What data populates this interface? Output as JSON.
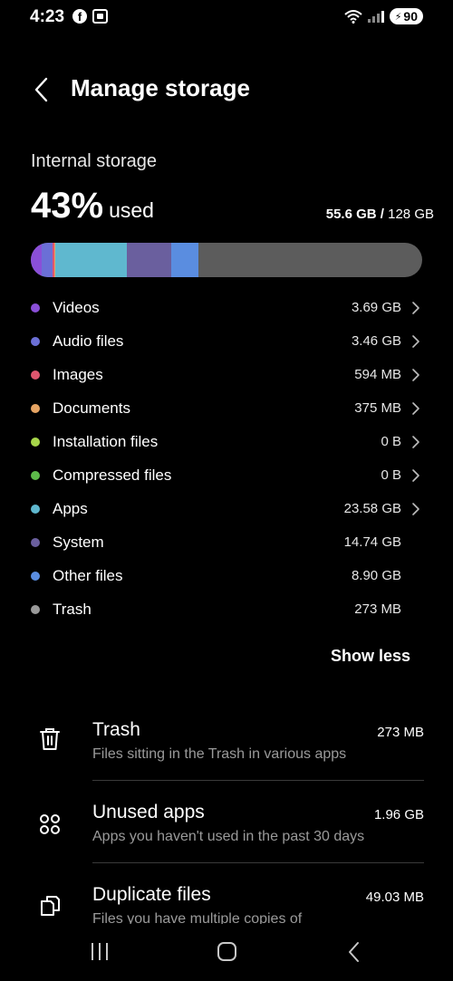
{
  "status_bar": {
    "time": "4:23",
    "facebook_icon": "facebook-icon",
    "scan_icon": "screenshot-scan-icon",
    "wifi_icon": "wifi-icon",
    "signal_icon": "cell-signal-icon",
    "battery": "90"
  },
  "header": {
    "back_icon": "chevron-left-icon",
    "title": "Manage storage"
  },
  "storage": {
    "label": "Internal storage",
    "percent": "43%",
    "percent_suffix": "used",
    "used": "55.6 GB /",
    "total": " 128 GB",
    "bar_fill_fraction": 0.43
  },
  "categories": [
    {
      "name": "Videos",
      "size": "3.69 GB",
      "color": "#8a4fd8",
      "has_chevron": true
    },
    {
      "name": "Audio files",
      "size": "3.46 GB",
      "color": "#6b6fd6",
      "has_chevron": true
    },
    {
      "name": "Images",
      "size": "594 MB",
      "color": "#e0566e",
      "has_chevron": true
    },
    {
      "name": "Documents",
      "size": "375 MB",
      "color": "#e6a463",
      "has_chevron": true
    },
    {
      "name": "Installation files",
      "size": "0 B",
      "color": "#a7d64a",
      "has_chevron": true
    },
    {
      "name": "Compressed files",
      "size": "0 B",
      "color": "#5dbb4a",
      "has_chevron": true
    },
    {
      "name": "Apps",
      "size": "23.58 GB",
      "color": "#5fb8cf",
      "has_chevron": true
    },
    {
      "name": "System",
      "size": "14.74 GB",
      "color": "#6a5f9e",
      "has_chevron": false
    },
    {
      "name": "Other files",
      "size": "8.90 GB",
      "color": "#5a8de0",
      "has_chevron": false
    },
    {
      "name": "Trash",
      "size": "273 MB",
      "color": "#9a9a9a",
      "has_chevron": false
    }
  ],
  "show_less_label": "Show less",
  "recommendations": [
    {
      "title": "Trash",
      "size": "273 MB",
      "description": "Files sitting in the Trash in various apps",
      "icon": "trash-icon"
    },
    {
      "title": "Unused apps",
      "size": "1.96 GB",
      "description": "Apps you haven't used in the past 30 days",
      "icon": "apps-grid-icon"
    },
    {
      "title": "Duplicate files",
      "size": "49.03 MB",
      "description": "Files you have multiple copies of",
      "icon": "duplicate-files-icon"
    }
  ],
  "nav": {
    "recent_icon": "recent-apps-icon",
    "home_icon": "home-icon",
    "back_icon": "back-icon"
  }
}
